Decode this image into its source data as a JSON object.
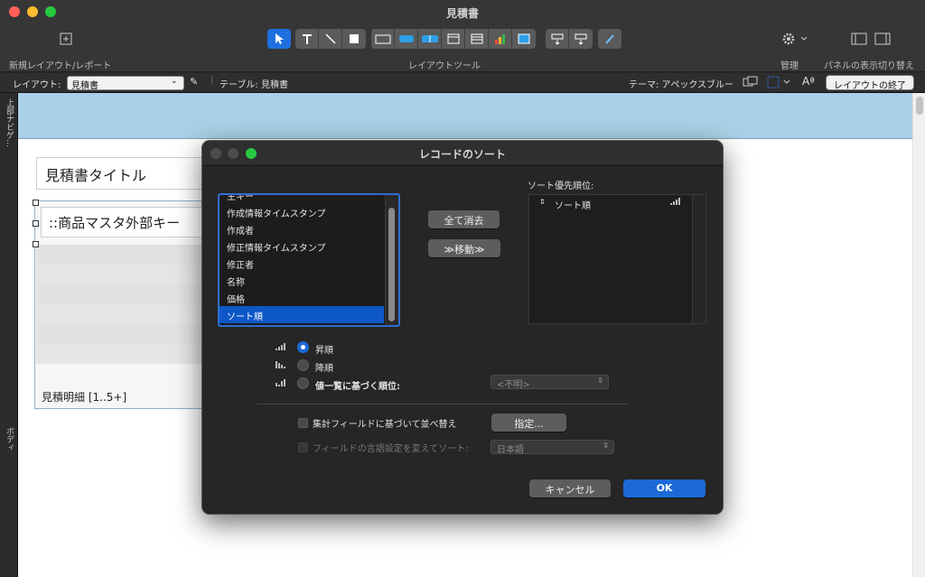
{
  "window": {
    "title": "見積書"
  },
  "toolbar": {
    "new_layout_label": "新規レイアウト/レポート",
    "layout_tools_label": "レイアウトツール",
    "manage_label": "管理",
    "panel_toggle_label": "パネルの表示切り替え",
    "tools": [
      "select-arrow",
      "text-tool",
      "line-tool",
      "rect-tool",
      "field-tool",
      "button-tool",
      "button-bar-tool",
      "popover-tool",
      "portal-tool",
      "chart-tool",
      "web-viewer-tool",
      "field-picker",
      "field-control",
      "format-painter"
    ]
  },
  "layoutbar": {
    "layout_prefix": "レイアウト:",
    "layout_value": "見積書",
    "table_text": "テーブル: 見積書",
    "theme_text": "テーマ: アペックスブルー",
    "exit_label": "レイアウトの終了"
  },
  "gutter": {
    "top_nav": "上部ナビゲ…",
    "body": "ボディ"
  },
  "canvas": {
    "title_field": "見積書タイトル",
    "portal_field": "::商品マスタ外部キー",
    "portal_label": "見積明細 [1..5+]"
  },
  "dialog": {
    "title": "レコードのソート",
    "fields": [
      "主キー",
      "作成情報タイムスタンプ",
      "作成者",
      "修正情報タイムスタンプ",
      "修正者",
      "名称",
      "価格",
      "ソート順"
    ],
    "selected_field": "ソート順",
    "clear_all_label": "全て消去",
    "move_label": "≫移動≫",
    "priority_label": "ソート優先順位:",
    "priority_items": [
      {
        "name": "ソート順"
      }
    ],
    "ascending_label": "昇順",
    "descending_label": "降順",
    "value_list_label": "値一覧に基づく順位:",
    "value_list_placeholder": "<不明>",
    "summary_check_label": "集計フィールドに基づいて並べ替え",
    "specify_label": "指定...",
    "language_check_label": "フィールドの言語設定を変えてソート:",
    "language_value": "日本語",
    "cancel_label": "キャンセル",
    "ok_label": "OK",
    "accent": "#1c6ad8"
  }
}
